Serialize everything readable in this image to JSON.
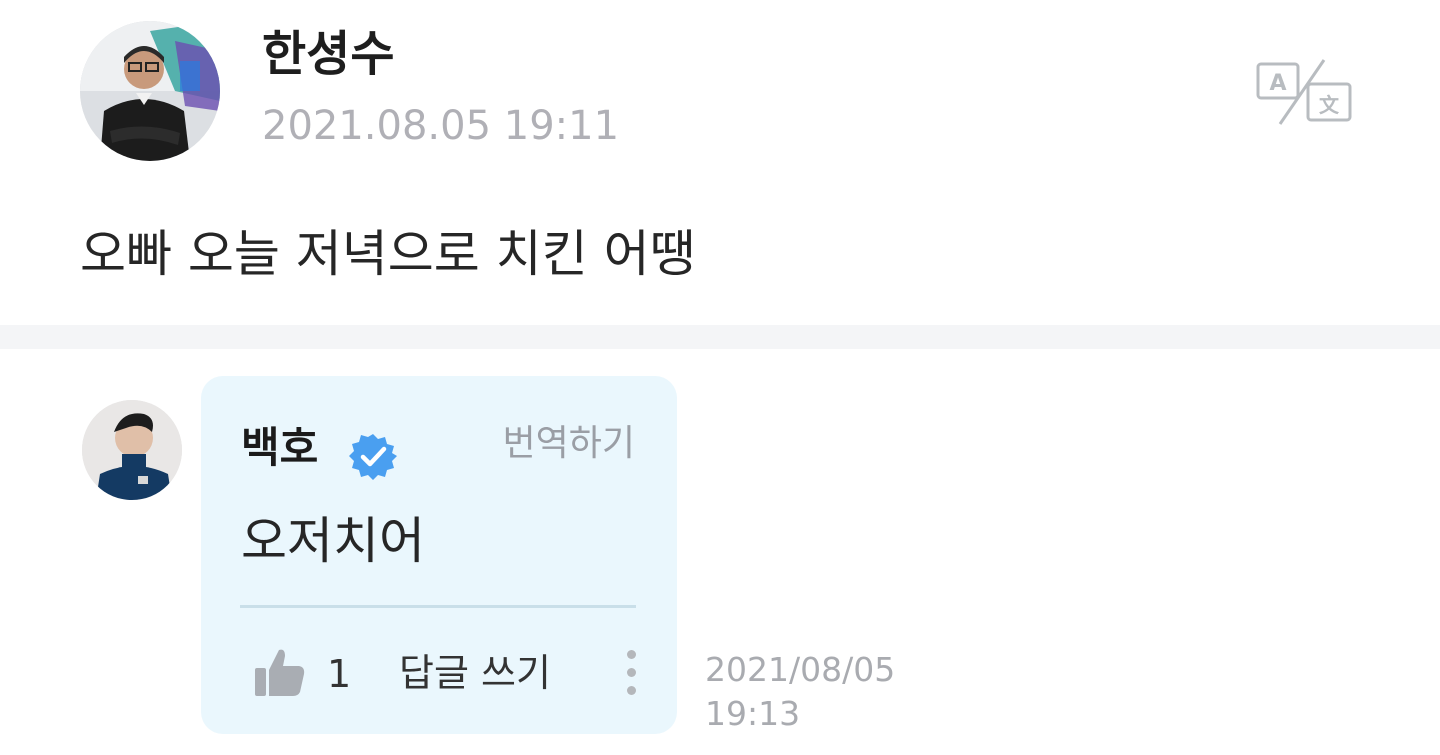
{
  "post": {
    "author": "한셩수",
    "timestamp": "2021.08.05 19:11",
    "text": "오빠 오늘 저녁으로 치킨 어땡",
    "translate_icon": "translate-icon"
  },
  "comment": {
    "author": "백호",
    "verified_icon": "verified-badge-icon",
    "translate_label": "번역하기",
    "text": "오저치어",
    "likes": "1",
    "reply_label": "답글 쓰기",
    "date": "2021/08/05",
    "time": "19:13"
  },
  "colors": {
    "bubble_bg": "#eaf7fd",
    "verified_blue": "#4a9ff0",
    "muted_text": "#b0b0b6",
    "divider_band": "#f4f5f7"
  }
}
